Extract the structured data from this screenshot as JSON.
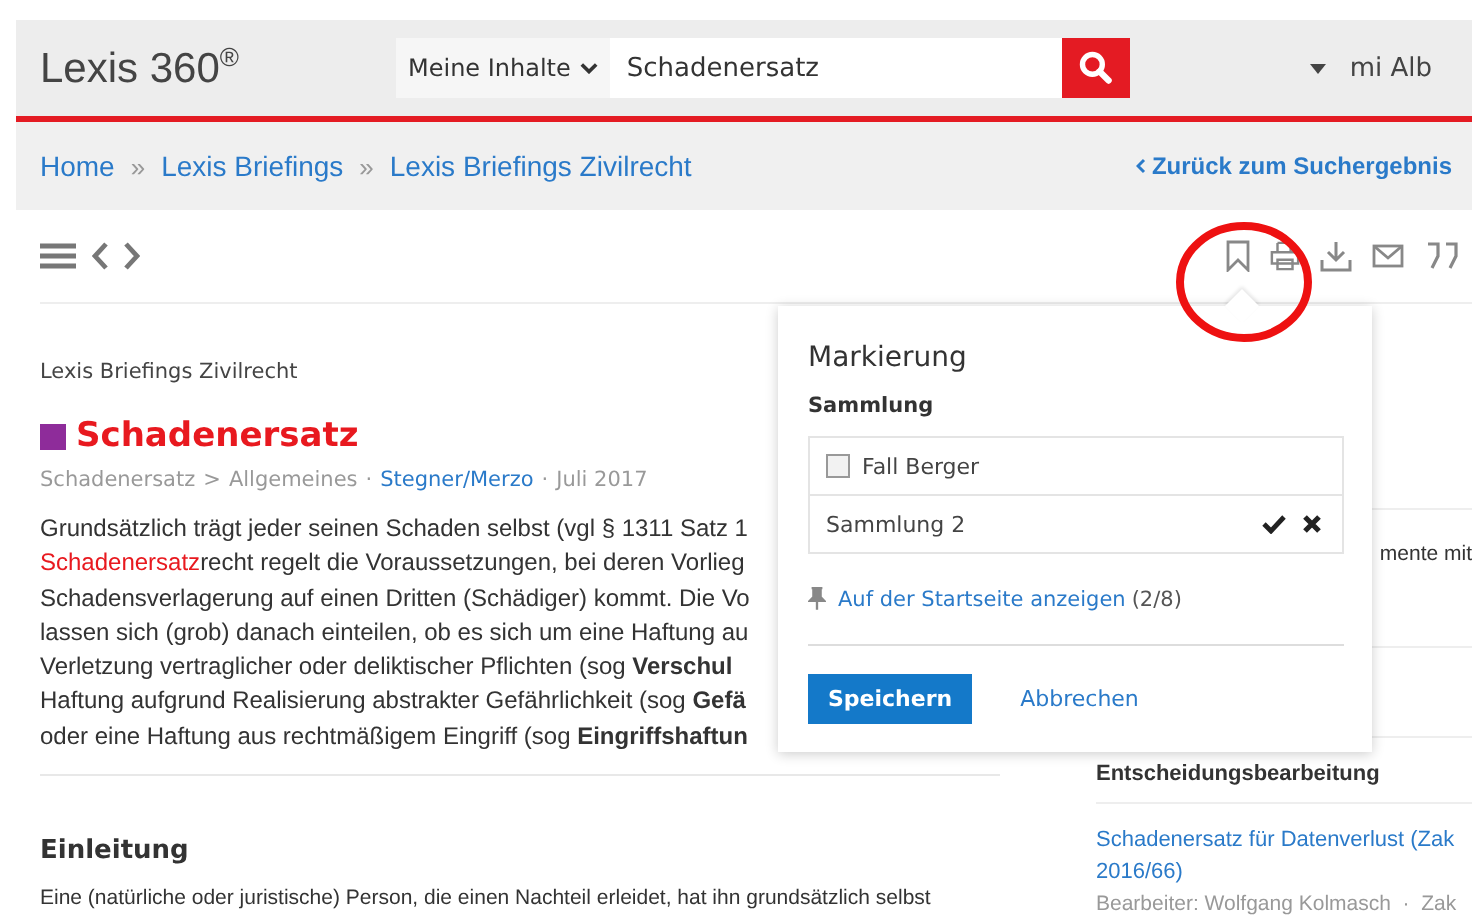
{
  "header": {
    "logo": "Lexis 360",
    "logo_mark": "®",
    "scope": "Meine Inhalte",
    "query": "Schadenersatz",
    "user": "mi Alb"
  },
  "breadcrumb": {
    "items": [
      "Home",
      "Lexis Briefings",
      "Lexis Briefings Zivilrecht"
    ],
    "separator": "»",
    "back": "Zurück zum Suchergebnis"
  },
  "article": {
    "source": "Lexis Briefings Zivilrecht",
    "title": "Schadenersatz",
    "meta": [
      {
        "kind": "crumb",
        "text": "Schadenersatz"
      },
      {
        "kind": "sep",
        "text": ">"
      },
      {
        "kind": "crumb",
        "text": "Allgemeines"
      },
      {
        "kind": "dot",
        "text": "·"
      },
      {
        "kind": "link",
        "text": "Stegner/Merzo"
      },
      {
        "kind": "dot",
        "text": "·"
      },
      {
        "kind": "crumb",
        "text": "Juli 2017"
      }
    ],
    "lines": [
      {
        "text": "Grundsätzlich trägt jeder seinen Schaden selbst (vgl § 1311 Satz 1"
      },
      {
        "highlight": "Schadenersatz",
        "text": "recht regelt die Voraussetzungen, bei deren Vorlieg"
      },
      {
        "text": "Schadensverlagerung auf einen Dritten (Schädiger) kommt. Die Vo"
      },
      {
        "text": "lassen sich (grob) danach einteilen, ob es sich um eine Haftung au"
      },
      {
        "text": "Verletzung vertraglicher oder deliktischer Pflichten (sog **Verschul**"
      },
      {
        "text": "Haftung aufgrund Realisierung abstrakter Gefährlichkeit (sog **Gefä**"
      },
      {
        "text": "oder eine Haftung aus rechtmäßigem Eingriff (sog **Eingriffshaftun**"
      }
    ],
    "section_title": "Einleitung",
    "section_text": "Eine (natürliche oder juristische) Person, die einen Nachteil erleidet, hat ihn grundsätzlich selbst"
  },
  "sidebar": {
    "fragment": "mente mit",
    "heading": "Entscheidungsbearbeitung",
    "link": "Schadenersatz für Datenverlust (Zak 2016/66)",
    "meta": "Bearbeiter: Wolfgang Kolmasch  ·  Zak"
  },
  "popup": {
    "title": "Markierung",
    "label": "Sammlung",
    "collections": [
      {
        "kind": "checkbox",
        "name": "Fall Berger",
        "checked": false
      },
      {
        "kind": "edit",
        "name": "Sammlung 2"
      }
    ],
    "pin_link": "Auf der Startseite anzeigen",
    "pin_count": "(2/8)",
    "save": "Speichern",
    "cancel": "Abbrechen"
  }
}
